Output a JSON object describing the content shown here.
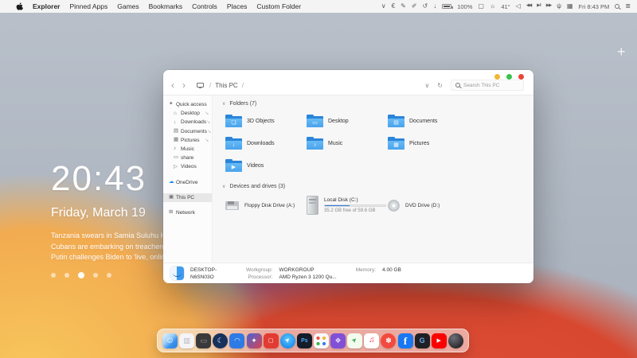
{
  "menu_bar": {
    "menus": [
      "Explorer",
      "Pinned Apps",
      "Games",
      "Bookmarks",
      "Controls",
      "Places",
      "Custom Folder"
    ],
    "status_icons": [
      {
        "name": "chevron-down-icon",
        "glyph": "∨"
      },
      {
        "name": "currency-icon",
        "glyph": "€"
      },
      {
        "name": "pen-icon",
        "glyph": "✎"
      },
      {
        "name": "pencil-icon",
        "glyph": "✐"
      },
      {
        "name": "history-icon",
        "glyph": "↺"
      },
      {
        "name": "download-icon",
        "glyph": "↓"
      },
      {
        "name": "display-icon",
        "glyph": "▢"
      },
      {
        "name": "volume-icon",
        "glyph": "◁"
      },
      {
        "name": "rewind-icon",
        "glyph": "◀◀"
      },
      {
        "name": "play-pause-icon",
        "glyph": "▶‖"
      },
      {
        "name": "fast-forward-icon",
        "glyph": "▶▶"
      },
      {
        "name": "mic-icon",
        "glyph": "ψ"
      },
      {
        "name": "keyboard-icon",
        "glyph": "▦"
      },
      {
        "name": "control-center-icon",
        "glyph": "≣"
      }
    ],
    "battery": {
      "label": "100%"
    },
    "weather": {
      "glyph": "☼",
      "label": "41°"
    },
    "clock": "Fri 8:43 PM"
  },
  "desktop": {
    "widget": {
      "time": "20:43",
      "date": "Friday, March 19",
      "news": [
        "Tanzania swears in Samia Suluhu Hassan as firs",
        "Cubans are embarking on treacherous sea journ",
        "Putin challenges Biden to 'live, online' conversat"
      ],
      "dots_total": 5,
      "dots_active_index": 2
    },
    "add_widget_glyph": "+"
  },
  "explorer_window": {
    "traffic_lights": {
      "colors": [
        "#f2b632",
        "#37c24e",
        "#e8463c"
      ]
    },
    "nav": {
      "back_glyph": "‹",
      "forward_glyph": "›",
      "separator": "/",
      "location": "This PC",
      "dropdown_glyph": "∨",
      "refresh_glyph": "↻",
      "search_placeholder": "Search This PC"
    },
    "sidebar": {
      "pin_glyph": "⊸",
      "items": [
        {
          "label": "Quick access",
          "glyph": "✦"
        },
        {
          "label": "Desktop",
          "glyph": "⌂"
        },
        {
          "label": "Downloads",
          "glyph": "↓"
        },
        {
          "label": "Documents",
          "glyph": "▤"
        },
        {
          "label": "Pictures",
          "glyph": "▦"
        },
        {
          "label": "Music",
          "glyph": "♪"
        },
        {
          "label": "share",
          "glyph": "▭"
        },
        {
          "label": "Videos",
          "glyph": "▷"
        },
        {
          "label": "OneDrive",
          "glyph": "☁"
        },
        {
          "label": "This PC",
          "glyph": "▣"
        },
        {
          "label": "Network",
          "glyph": "⊞"
        }
      ]
    },
    "content": {
      "folders": {
        "title": "Folders (7)",
        "collapse_glyph": "∨",
        "items": [
          {
            "label": "3D Objects",
            "glyph": "❏"
          },
          {
            "label": "Desktop",
            "glyph": "▭"
          },
          {
            "label": "Documents",
            "glyph": "▤"
          },
          {
            "label": "Downloads",
            "glyph": "↓"
          },
          {
            "label": "Music",
            "glyph": "♪"
          },
          {
            "label": "Pictures",
            "glyph": "▦"
          },
          {
            "label": "Videos",
            "glyph": "▶"
          }
        ]
      },
      "drives": {
        "title": "Devices and drives (3)",
        "collapse_glyph": "∨",
        "items": [
          {
            "label": "Floppy Disk Drive (A:)"
          },
          {
            "label": "Local Disk (C:)",
            "free_text": "35.2 GB free of 59.6 GB",
            "used_percent": 41
          },
          {
            "label": "DVD Drive (D:)"
          }
        ]
      }
    },
    "status_bar": {
      "computer_name": "DESKTOP-N6SN03O",
      "workgroup_label": "Workgroup:",
      "workgroup_value": "WORKGROUP",
      "processor_label": "Processor:",
      "processor_value": "AMD Ryzen 3 1200 Qu...",
      "memory_label": "Memory:",
      "memory_value": "4.00 GB"
    }
  },
  "dock": {
    "items": [
      {
        "name": "finder-icon",
        "glyph": "☺",
        "bg": "linear-gradient(135deg,#e8f4fe 0%,#9fd0f8 40%,#3c95ee 65%,#2b7ce2 100%)",
        "fg": "#ffffff"
      },
      {
        "name": "trash-icon",
        "glyph": "▥",
        "bg": "#f4f4f6",
        "fg": "#b6b6bc"
      },
      {
        "name": "phone-icon",
        "glyph": "▭",
        "bg": "#39393b",
        "fg": "#98989d"
      },
      {
        "name": "moon-app-icon",
        "glyph": "☾",
        "bg": "#16325c",
        "fg": "#ecf1fa"
      },
      {
        "name": "chat-app-icon",
        "glyph": "◠",
        "bg": "#2e7be5",
        "fg": "#d6e7ff"
      },
      {
        "name": "red-blue-app-icon",
        "glyph": "✦",
        "bg": "linear-gradient(135deg,#4a63d8 0%,#d8434e 100%)",
        "fg": "#ffffff"
      },
      {
        "name": "red-app-icon",
        "glyph": "▢",
        "bg": "#e23c32",
        "fg": "#ffffff"
      },
      {
        "name": "safari-icon",
        "glyph": "➤",
        "bg": "radial-gradient(circle at 50% 38%,#5ac8fa 0%,#1f8ef0 72%)",
        "fg": "#ffffff"
      },
      {
        "name": "photoshop-icon",
        "glyph": "Ps",
        "bg": "#141c2a",
        "fg": "#4aa8ff"
      },
      {
        "name": "launchpad-icon",
        "glyph": "",
        "bg": "#f7f8fa",
        "fg": "#999999"
      },
      {
        "name": "purple-app-icon",
        "glyph": "❖",
        "bg": "#8150d6",
        "fg": "#eadfff"
      },
      {
        "name": "maps-icon",
        "glyph": "➤",
        "bg": "#f2fbee",
        "fg": "#34a853"
      },
      {
        "name": "music-icon",
        "glyph": "♫",
        "bg": "#ffffff",
        "fg": "#fa2d48"
      },
      {
        "name": "red-circle-app-icon",
        "glyph": "✽",
        "bg": "#f4493e",
        "fg": "#ffffff"
      },
      {
        "name": "facebook-icon",
        "glyph": "f",
        "bg": "#1877f2",
        "fg": "#ffffff"
      },
      {
        "name": "google-icon",
        "glyph": "G",
        "bg": "#1f2023",
        "fg": "#6fa8f5"
      },
      {
        "name": "youtube-icon",
        "glyph": "▶",
        "bg": "#fd0000",
        "fg": "#ffffff"
      },
      {
        "name": "dark-sphere-icon",
        "glyph": "",
        "bg": "radial-gradient(circle at 35% 30%,#70707a 0%,#27272b 75%)",
        "fg": "#9a9aa2"
      }
    ]
  }
}
